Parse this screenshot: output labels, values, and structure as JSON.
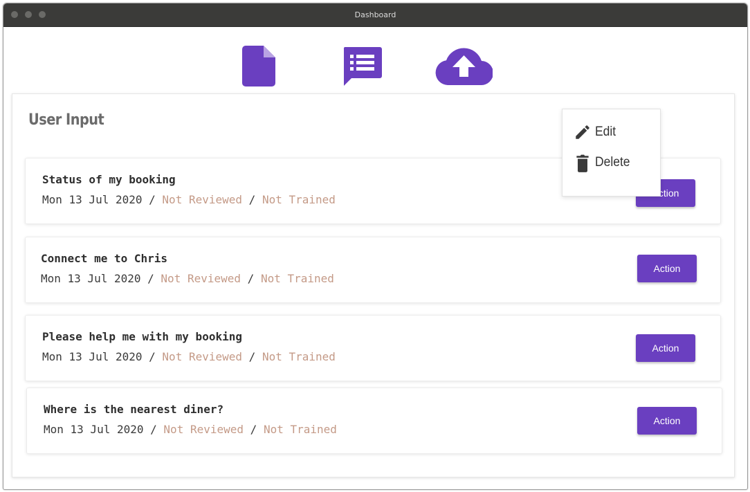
{
  "window": {
    "title": "Dashboard"
  },
  "toolbar": {
    "icons": [
      "document-icon",
      "list-chat-icon",
      "cloud-upload-icon"
    ],
    "accent": "#6a3fc0"
  },
  "panel": {
    "title": "User Input"
  },
  "context_menu": {
    "edit": {
      "label": "Edit",
      "icon": "pencil-icon"
    },
    "delete": {
      "label": "Delete",
      "icon": "trash-icon"
    }
  },
  "items": [
    {
      "title": "Status of my booking",
      "date": "Mon 13 Jul 2020",
      "review_status": "Not Reviewed",
      "train_status": "Not Trained",
      "action_label": "Action"
    },
    {
      "title": "Connect me to Chris",
      "date": "Mon 13 Jul 2020",
      "review_status": "Not Reviewed",
      "train_status": "Not Trained",
      "action_label": "Action"
    },
    {
      "title": "Please help me with my booking",
      "date": "Mon 13 Jul 2020",
      "review_status": "Not Reviewed",
      "train_status": "Not Trained",
      "action_label": "Action"
    },
    {
      "title": "Where is the nearest diner?",
      "date": "Mon 13 Jul 2020",
      "review_status": "Not Reviewed",
      "train_status": "Not Trained",
      "action_label": "Action"
    }
  ],
  "separator": "/",
  "colors": {
    "status_text": "#c49a87",
    "button_bg": "#6a3fc0",
    "titlebar": "#3b3b39"
  }
}
